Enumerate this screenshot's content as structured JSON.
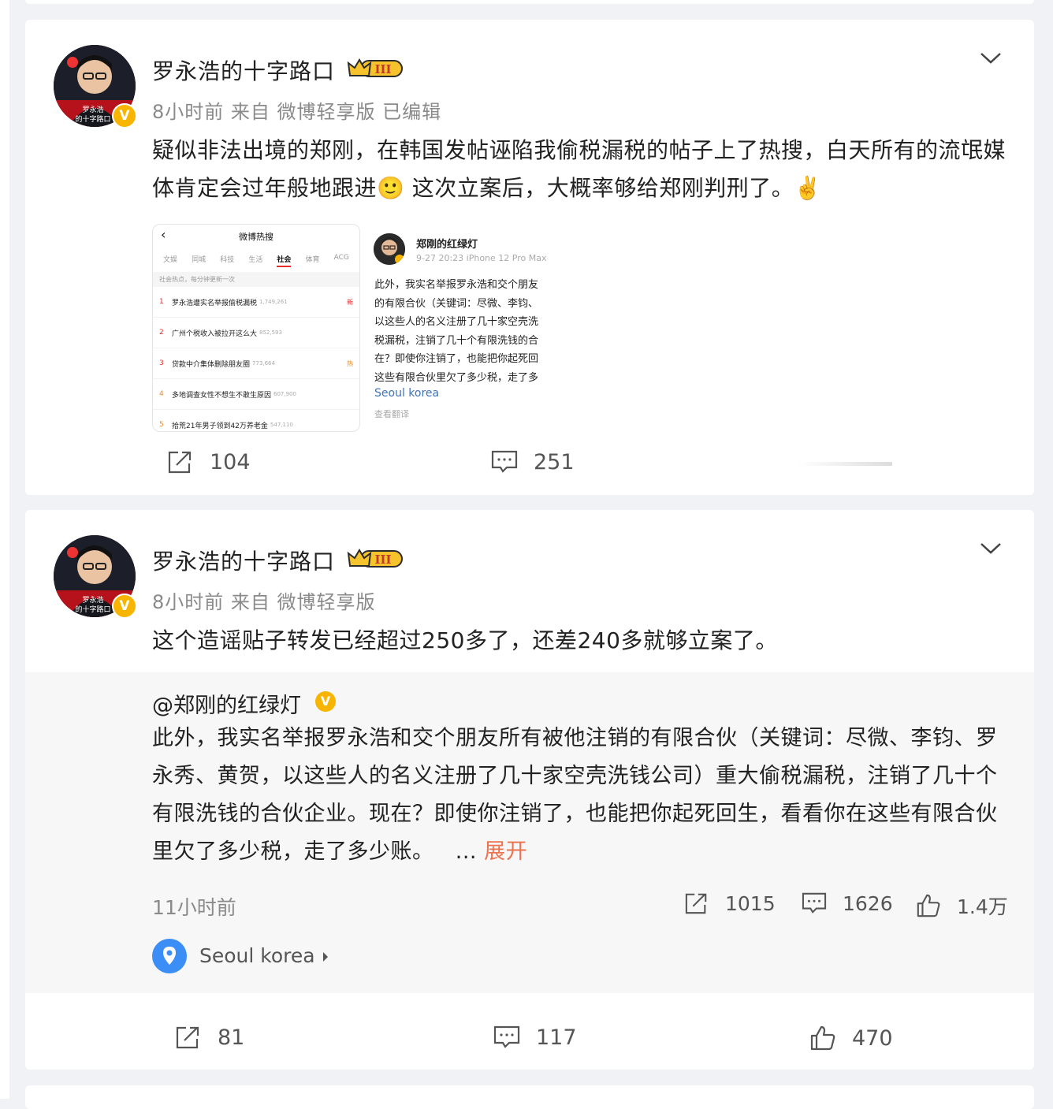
{
  "posts": [
    {
      "author": "罗永浩的十字路口",
      "level_badge": "III",
      "meta": "8小时前 来自 微博轻享版 已编辑",
      "text": "疑似非法出境的郑刚，在韩国发帖诬陷我偷税漏税的帖子上了热搜，白天所有的流氓媒体肯定会过年般地跟进🙂 这次立案后，大概率够给郑刚判刑了。✌️",
      "hotsearch_image": {
        "title": "微博热搜",
        "tabs": [
          "文娱",
          "同城",
          "科技",
          "生活",
          "社会",
          "体育",
          "ACG"
        ],
        "active_tab": "社会",
        "subtitle": "社会热点，每分钟更新一次",
        "rows": [
          {
            "rank": "1",
            "title": "罗永浩遭实名举报偷税漏税",
            "count": "1,749,261",
            "tag": "新"
          },
          {
            "rank": "2",
            "title": "广州个税收入被拉开这么大",
            "count": "852,593",
            "tag": ""
          },
          {
            "rank": "3",
            "title": "贷款中介集体删除朋友圈",
            "count": "773,664",
            "tag": "热"
          },
          {
            "rank": "4",
            "title": "多地调查女性不想生不敢生原因",
            "count": "607,900",
            "tag": ""
          },
          {
            "rank": "5",
            "title": "拾荒21年男子领到42万养老金",
            "count": "547,110",
            "tag": ""
          }
        ]
      },
      "screenshot_image": {
        "name": "郑刚的红绿灯",
        "meta": "9-27 20:23  iPhone 12 Pro Max",
        "lines": [
          "此外，我实名举报罗永浩和交个朋友",
          "的有限合伙（关键词：尽微、李钧、",
          "以这些人的名义注册了几十家空壳洗",
          "税漏税，注销了几十个有限洗钱的合",
          "在？即使你注销了，也能把你起死回",
          "这些有限合伙里欠了多少税，走了多"
        ],
        "location": "Seoul korea",
        "translate": "查看翻译"
      },
      "actions": {
        "repost": "104",
        "comment": "251"
      }
    },
    {
      "author": "罗永浩的十字路口",
      "level_badge": "III",
      "meta": "8小时前 来自 微博轻享版",
      "text": "这个造谣贴子转发已经超过250多了，还差240多就够立案了。",
      "repost": {
        "author": "@郑刚的红绿灯",
        "text": "此外，我实名举报罗永浩和交个朋友所有被他注销的有限合伙（关键词：尽微、李钧、罗永秀、黄贺，以这些人的名义注册了几十家空壳洗钱公司）重大偷税漏税，注销了几十个有限洗钱的合伙企业。现在？即使你注销了，也能把你起死回生，看看你在这些有限合伙里欠了多少税，走了多少账。",
        "ellipsis": "...",
        "expand": "展开",
        "time": "11小时前",
        "stats": {
          "repost": "1015",
          "comment": "1626",
          "like": "1.4万"
        },
        "location": "Seoul korea"
      },
      "actions": {
        "repost": "81",
        "comment": "117",
        "like": "470"
      }
    }
  ],
  "colors": {
    "background": "#f1f2f5",
    "card": "#ffffff",
    "badge": "#f7b500",
    "link": "#eb7350",
    "pin": "#3a8ef6"
  }
}
